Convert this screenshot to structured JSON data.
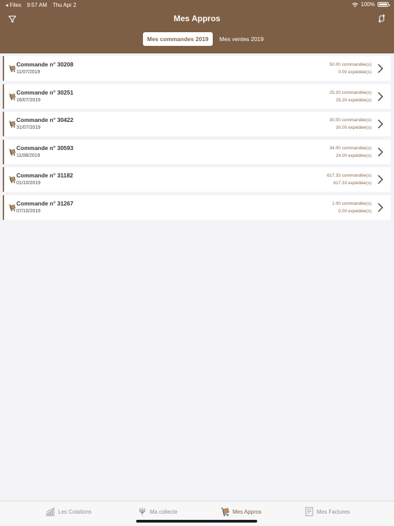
{
  "status_bar": {
    "back_app": "◂ Files",
    "time": "9:57 AM",
    "date": "Thu Apr 2",
    "battery": "100%"
  },
  "header": {
    "title": "Mes Appros",
    "segments": [
      {
        "label": "Mes commandes 2019",
        "active": true
      },
      {
        "label": "Mes ventes 2019",
        "active": false
      }
    ]
  },
  "orders": [
    {
      "title": "Commande n° 30208",
      "date": "11/07/2019",
      "ordered": "50.00 commandée(s)",
      "shipped": "0.00 expédiée(s)"
    },
    {
      "title": "Commande n° 30251",
      "date": "16/07/2019",
      "ordered": "25.20 commandée(s)",
      "shipped": "25.20 expédiée(s)"
    },
    {
      "title": "Commande n° 30422",
      "date": "31/07/2019",
      "ordered": "30.00 commandée(s)",
      "shipped": "30.00 expédiée(s)"
    },
    {
      "title": "Commande n° 30593",
      "date": "11/08/2019",
      "ordered": "34.00 commandée(s)",
      "shipped": "24.00 expédiée(s)"
    },
    {
      "title": "Commande n° 31182",
      "date": "01/10/2019",
      "ordered": "617.33 commandée(s)",
      "shipped": "617.33 expédiée(s)"
    },
    {
      "title": "Commande n° 31267",
      "date": "07/10/2019",
      "ordered": "1.00 commandée(s)",
      "shipped": "0.00 expédiée(s)"
    }
  ],
  "tabbar": {
    "tabs": [
      {
        "label": "Les Cotations",
        "icon": "chart-icon",
        "active": false
      },
      {
        "label": "Ma collecte",
        "icon": "wheat-icon",
        "active": false
      },
      {
        "label": "Mes Appros",
        "icon": "cart-icon",
        "active": true
      },
      {
        "label": "Mes Factures",
        "icon": "invoice-icon",
        "active": false
      }
    ]
  },
  "colors": {
    "brand": "#7d5f45",
    "accent": "#8b6a4f",
    "background": "#f2f2f7"
  }
}
